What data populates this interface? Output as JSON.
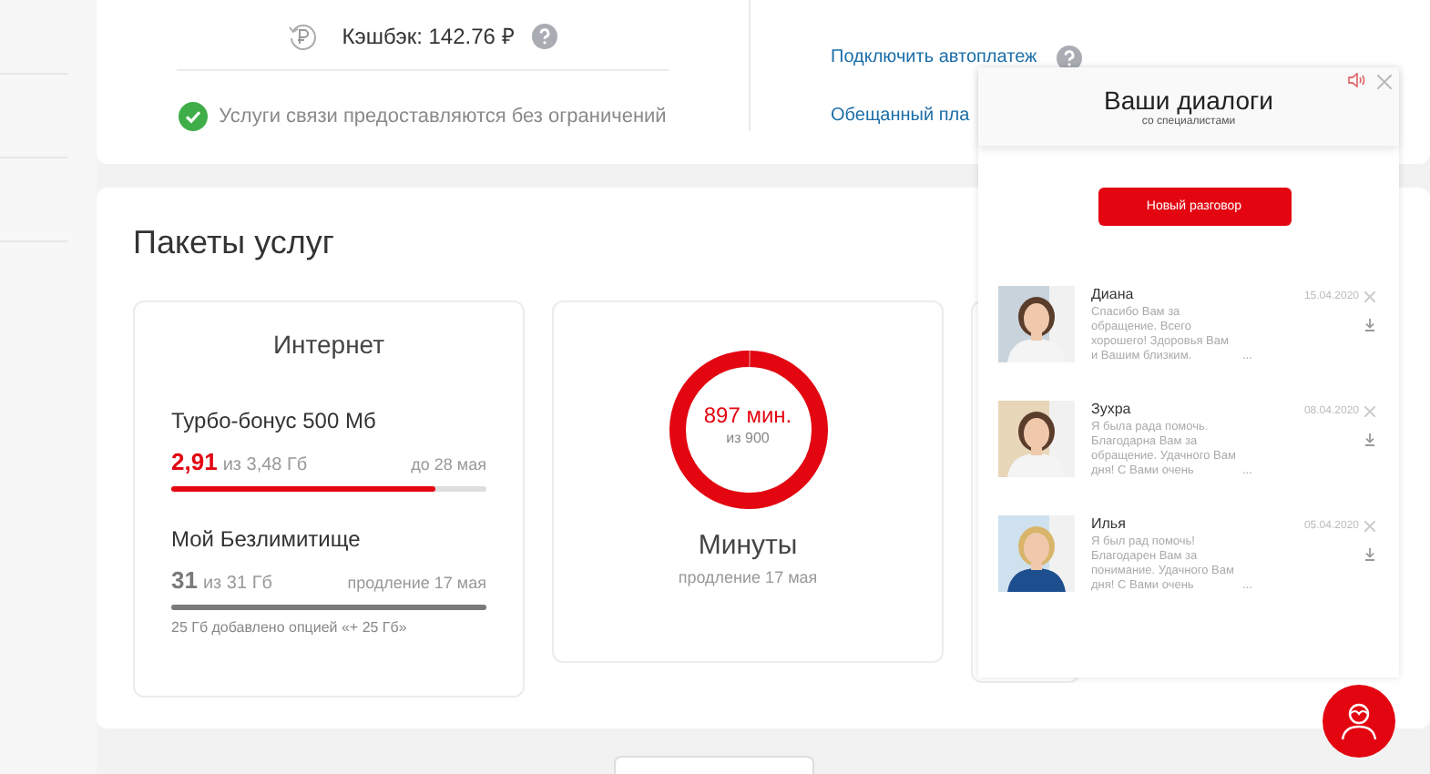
{
  "account": {
    "cashback": "Кэшбэк: 142.76 ₽",
    "status": "Услуги связи предоставляются без ограничений",
    "links": [
      {
        "label": "Подключить автоплатеж",
        "help": true
      },
      {
        "label": "Обещанный пла",
        "help": false
      }
    ]
  },
  "packages": {
    "title": "Пакеты услуг",
    "internet": {
      "title": "Интернет",
      "items": [
        {
          "name": "Турбо-бонус 500 Мб",
          "used": "2,91",
          "total": "из 3,48 Гб",
          "note": "до 28 мая",
          "level": 0.84,
          "kind": "bonus"
        },
        {
          "name": "Мой Безлимитище",
          "used": "31",
          "total": "из 31 Гб",
          "note": "продление 17 мая",
          "level": 1,
          "kind": "main",
          "footnote": "25 Гб добавлено опцией «+ 25 Гб»"
        }
      ]
    },
    "minutes": {
      "value": "897 мин.",
      "total": "из 900",
      "level": 0.997,
      "title": "Минуты",
      "note": "продление 17 мая"
    }
  },
  "chat": {
    "title": "Ваши диалоги",
    "subtitle": "со специалистами",
    "new_button": "Новый разговор",
    "dialogs": [
      {
        "name": "Диана",
        "preview": "Спасибо Вам за обращение. Всего хорошего! Здоровья Вам и Вашим близким.",
        "more": "...",
        "date": "15.04.2020",
        "kind": "picture"
      },
      {
        "name": "Зухра",
        "preview": "Я была рада помочь. Благодарна Вам за обращение. Удачного Вам дня! С Вами очень",
        "more": "...",
        "date": "08.04.2020",
        "kind": "picture"
      },
      {
        "name": "Илья",
        "preview": "Я был рад помочь! Благодарен Вам за понимание. Удачного Вам дня! С Вами очень",
        "more": "...",
        "date": "05.04.2020",
        "kind": "picture"
      }
    ]
  }
}
